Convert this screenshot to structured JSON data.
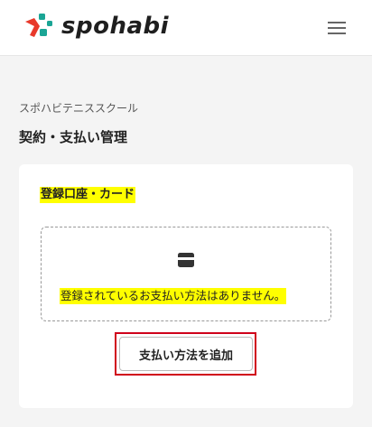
{
  "header": {
    "logo_text": "spohabi",
    "logo_icon": "spohabi-logo-mark",
    "menu_icon": "hamburger-menu-icon"
  },
  "page": {
    "school_name": "スポハビテニススクール",
    "title": "契約・支払い管理"
  },
  "payment_section": {
    "title": "登録口座・カード",
    "empty_icon": "credit-card-icon",
    "empty_message": "登録されているお支払い方法はありません。",
    "add_button_label": "支払い方法を追加"
  },
  "colors": {
    "highlight": "#ffff00",
    "frame": "#d0021b",
    "logo_red": "#e8392b",
    "logo_teal": "#1aa595"
  }
}
